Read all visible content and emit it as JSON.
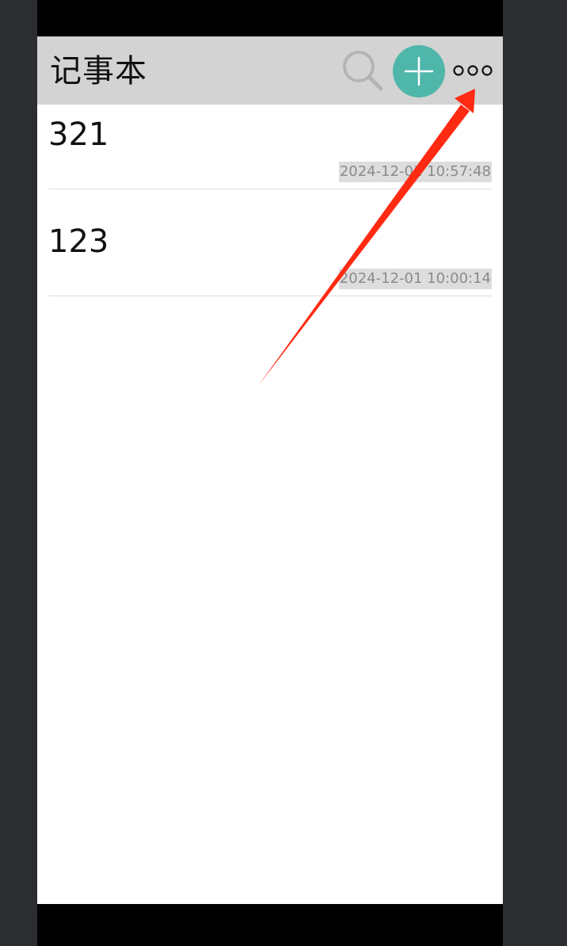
{
  "app": {
    "title": "记事本"
  },
  "toolbar": {
    "search_icon": "search-icon",
    "add_icon": "plus-icon",
    "more_icon": "more-options-icon",
    "accent_color": "#4fb6aa"
  },
  "notes": [
    {
      "title": "321",
      "timestamp": "2024-12-01 10:57:48"
    },
    {
      "title": "123",
      "timestamp": "2024-12-01 10:00:14"
    }
  ],
  "annotation": {
    "arrow_color": "#ff2a12"
  }
}
